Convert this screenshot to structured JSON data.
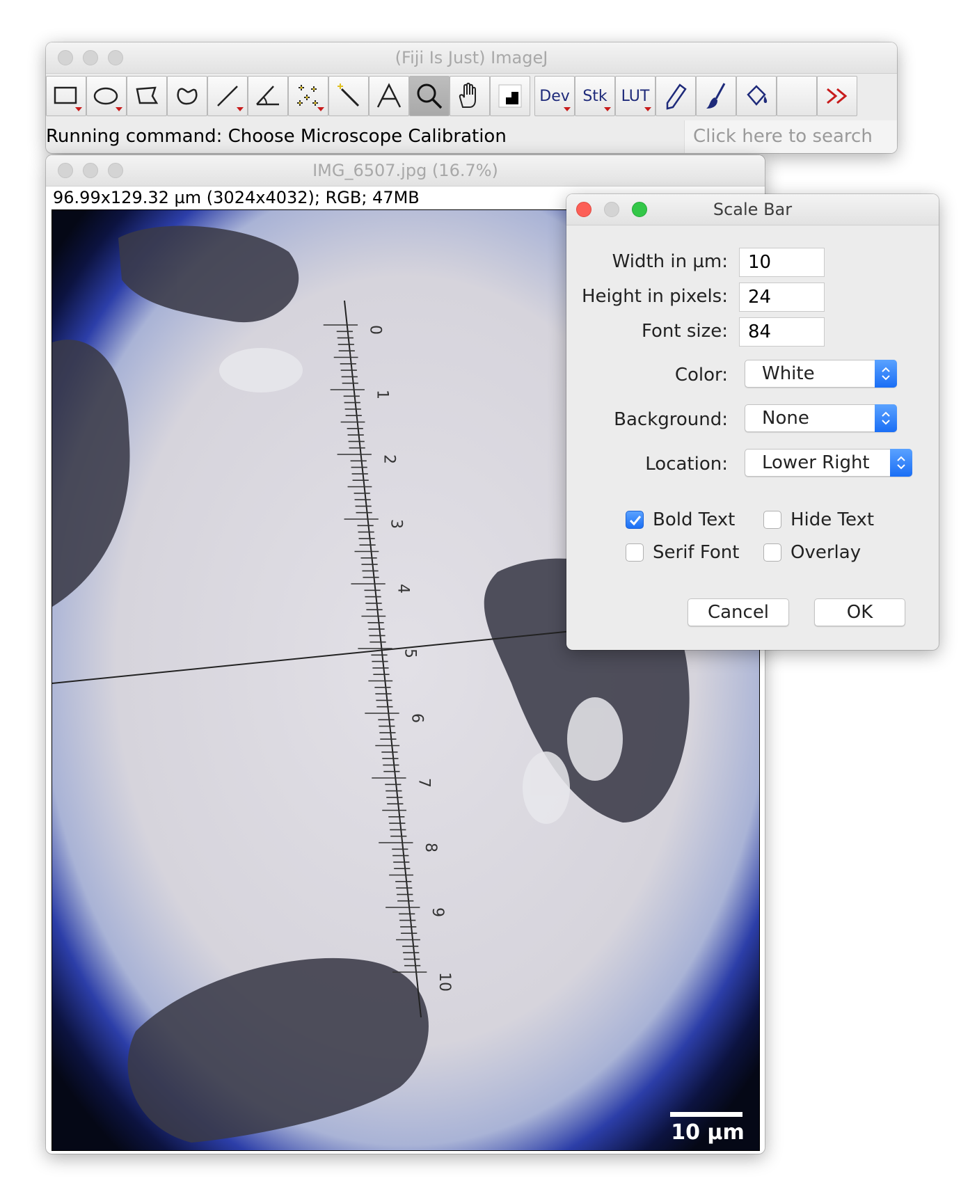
{
  "imagej_window": {
    "title": "(Fiji Is Just) ImageJ",
    "status_text": "Running command: Choose Microscope Calibration",
    "search_placeholder": "Click here to search",
    "toolbar": [
      {
        "name": "rectangle-tool",
        "icon": "rectangle-icon"
      },
      {
        "name": "oval-tool",
        "icon": "oval-icon"
      },
      {
        "name": "polygon-tool",
        "icon": "polygon-icon"
      },
      {
        "name": "freehand-tool",
        "icon": "freehand-icon"
      },
      {
        "name": "line-tool",
        "icon": "line-icon"
      },
      {
        "name": "angle-tool",
        "icon": "angle-icon"
      },
      {
        "name": "point-tool",
        "icon": "point-icon"
      },
      {
        "name": "wand-tool",
        "icon": "wand-icon"
      },
      {
        "name": "text-tool",
        "icon": "text-icon",
        "label": "A"
      },
      {
        "name": "magnifier-tool",
        "icon": "magnifier-icon",
        "selected": true
      },
      {
        "name": "hand-tool",
        "icon": "hand-icon"
      },
      {
        "name": "color-picker-tool",
        "icon": "color-picker-icon"
      },
      {
        "name": "dev-menu",
        "label": "Dev"
      },
      {
        "name": "stk-menu",
        "label": "Stk"
      },
      {
        "name": "lut-menu",
        "label": "LUT"
      },
      {
        "name": "pencil-tool",
        "icon": "pencil-icon"
      },
      {
        "name": "brush-tool",
        "icon": "brush-icon"
      },
      {
        "name": "flood-fill-tool",
        "icon": "paint-bucket-icon"
      },
      {
        "name": "empty-slot"
      },
      {
        "name": "more-tools",
        "icon": "double-chevron-right-icon"
      }
    ]
  },
  "image_window": {
    "title": "IMG_6507.jpg (16.7%)",
    "info": "96.99x129.32 µm (3024x4032); RGB; 47MB",
    "scale_bar_label": "10 µm",
    "reticle_numbers": [
      "0",
      "1",
      "2",
      "3",
      "4",
      "5",
      "6",
      "7",
      "8",
      "9",
      "10"
    ]
  },
  "scale_bar_dialog": {
    "title": "Scale Bar",
    "width_label": "Width in µm:",
    "width_value": "10",
    "height_label": "Height in pixels:",
    "height_value": "24",
    "font_label": "Font size:",
    "font_value": "84",
    "color_label": "Color:",
    "color_value": "White",
    "background_label": "Background:",
    "background_value": "None",
    "location_label": "Location:",
    "location_value": "Lower Right",
    "bold_text": {
      "label": "Bold Text",
      "checked": true
    },
    "hide_text": {
      "label": "Hide Text",
      "checked": false
    },
    "serif_font": {
      "label": "Serif Font",
      "checked": false
    },
    "overlay": {
      "label": "Overlay",
      "checked": false
    },
    "cancel_label": "Cancel",
    "ok_label": "OK"
  },
  "colors": {
    "accent_blue": "#1a6ef5",
    "close_red": "#fc5f57",
    "minimize_gray": "#d4d4d4",
    "zoom_green": "#33c748",
    "tool_triangle_red": "#c81b1b",
    "toolbar_text_navy": "#1e2a7a"
  }
}
